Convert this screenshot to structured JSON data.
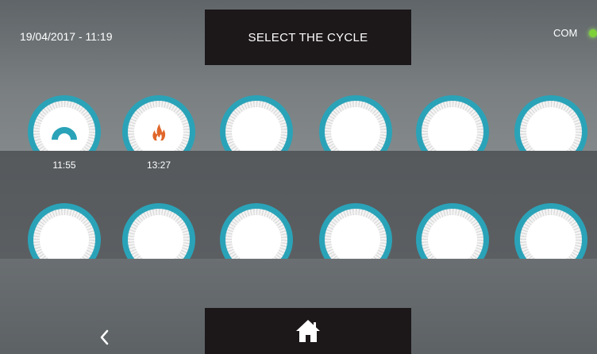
{
  "header": {
    "datetime": "19/04/2017 - 11:19",
    "title": "SELECT THE CYCLE",
    "com_label": "COM",
    "com_status_color": "#7fd13a"
  },
  "cycles_row1": [
    {
      "icon": "arch-icon",
      "time": "11:55"
    },
    {
      "icon": "flame-icon",
      "time": "13:27"
    },
    {
      "icon": "",
      "time": ""
    },
    {
      "icon": "",
      "time": ""
    },
    {
      "icon": "",
      "time": ""
    },
    {
      "icon": "",
      "time": ""
    }
  ],
  "cycles_row2": [
    {
      "icon": "",
      "time": ""
    },
    {
      "icon": "",
      "time": ""
    },
    {
      "icon": "",
      "time": ""
    },
    {
      "icon": "",
      "time": ""
    },
    {
      "icon": "",
      "time": ""
    },
    {
      "icon": "",
      "time": ""
    }
  ],
  "footer": {
    "back_icon": "chevron-left-icon",
    "home_icon": "home-icon"
  },
  "colors": {
    "dial_ring": "#2aa3b8",
    "arch_icon": "#2aa3b8",
    "flame_icon": "#e0662a"
  }
}
